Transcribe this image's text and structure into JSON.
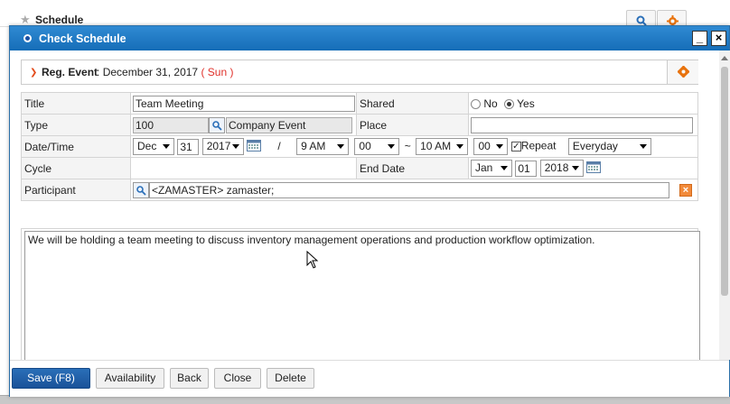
{
  "background": {
    "title": "Schedule"
  },
  "dialog": {
    "title": "Check Schedule",
    "minimize_label": "_",
    "close_label": "×"
  },
  "event": {
    "label": "Reg. Event",
    "separator": ":",
    "date": "December 31, 2017",
    "day": "( Sun )"
  },
  "form": {
    "title_label": "Title",
    "title_value": "Team Meeting",
    "shared_label": "Shared",
    "shared_no": "No",
    "shared_yes": "Yes",
    "shared_selected": "Yes",
    "type_label": "Type",
    "type_code": "100",
    "type_name": "Company Event",
    "place_label": "Place",
    "place_value": "",
    "datetime_label": "Date/Time",
    "start_month": "Dec",
    "start_day": "31",
    "start_year": "2017",
    "slash": "/",
    "start_hour": "9 AM",
    "start_min": "00",
    "tilde": "~",
    "end_hour": "10 AM",
    "end_min": "00",
    "repeat_label": "Repeat",
    "repeat_checked": true,
    "repeat_value": "Everyday",
    "cycle_label": "Cycle",
    "end_date_label": "End Date",
    "end_month": "Jan",
    "end_day": "01",
    "end_year": "2018",
    "participant_label": "Participant",
    "participant_value": "<ZAMASTER> zamaster;",
    "memo": "We will be holding a team meeting to discuss inventory management operations and production workflow optimization."
  },
  "footer": {
    "save": "Save (F8)",
    "availability": "Availability",
    "back": "Back",
    "close": "Close",
    "delete": "Delete"
  },
  "colors": {
    "titlebar": "#1f7dc6",
    "primary_button": "#1f5fa6",
    "accent_orange": "#e8720c",
    "day_red": "#e0302a"
  }
}
